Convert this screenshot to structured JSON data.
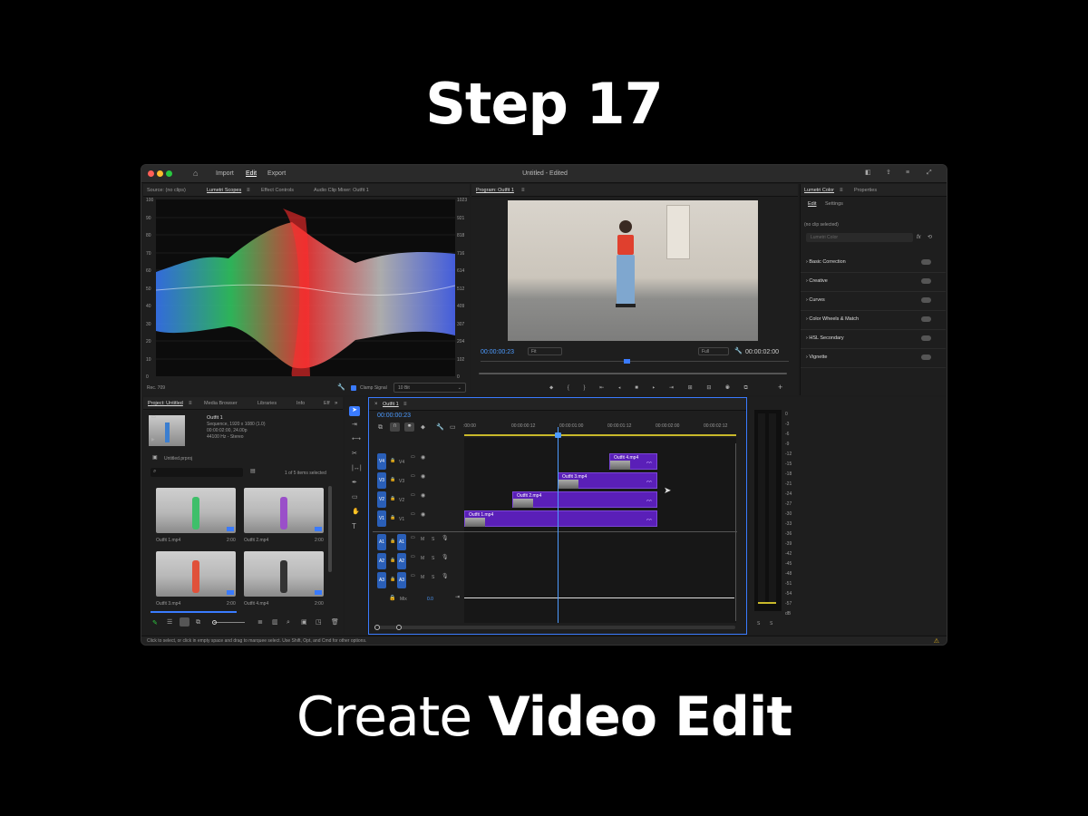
{
  "heading": "Step 17",
  "subheading": {
    "regular": "Create",
    "bold": "Video Edit"
  },
  "app": {
    "title": "Untitled - Edited",
    "menus": [
      "Import",
      "Edit",
      "Export"
    ],
    "source_panel": {
      "tabs": [
        "Source: (no clips)",
        "Lumetri Scopes",
        "Effect Controls",
        "Audio Clip Mixer: Outfit 1"
      ],
      "left_ticks": [
        "100",
        "90",
        "80",
        "70",
        "60",
        "50",
        "40",
        "30",
        "20",
        "10",
        "0"
      ],
      "right_ticks": [
        "1023",
        "921",
        "818",
        "716",
        "614",
        "512",
        "409",
        "307",
        "204",
        "102",
        "0"
      ],
      "footer_left": "Rec. 709",
      "clamp_label": "Clamp Signal",
      "bit_select": "10 Bit"
    },
    "program_panel": {
      "tab": "Program: Outfit 1",
      "timecode": "00:00:00:23",
      "fit": "Fit",
      "quality": "Full",
      "duration": "00:00:02:00"
    },
    "lumetri_panel": {
      "tabs": [
        "Lumetri Color",
        "Properties"
      ],
      "subtabs": [
        "Edit",
        "Settings"
      ],
      "status": "(no clip selected)",
      "dropdown": "Lumetri Color",
      "sections": [
        "Basic Correction",
        "Creative",
        "Curves",
        "Color Wheels & Match",
        "HSL Secondary",
        "Vignette"
      ]
    },
    "project_panel": {
      "tabs": [
        "Project: Untitled",
        "Media Browser",
        "Libraries",
        "Info",
        "Eff"
      ],
      "sequence_name": "Outfit 1",
      "sequence_info": [
        "Sequence, 1920 x 1080 (1.0)",
        "00:00:02:00, 24.00p",
        "44100 Hz - Stereo"
      ],
      "project_file": "Untitled.prproj",
      "selection": "1 of 5 items selected",
      "items": [
        {
          "name": "Outfit 1.mp4",
          "duration": "2:00",
          "color": "#3fbf6a"
        },
        {
          "name": "Outfit 2.mp4",
          "duration": "2:00",
          "color": "#9a4fc9"
        },
        {
          "name": "Outfit 3.mp4",
          "duration": "2:00",
          "color": "#e0513a"
        },
        {
          "name": "Outfit 4.mp4",
          "duration": "2:00",
          "color": "#333333"
        }
      ]
    },
    "timeline": {
      "tab": "Outfit 1",
      "timecode": "00:00:00:23",
      "ruler": [
        ":00:00",
        "00:00:00:12",
        "00:00:01:00",
        "00:00:01:12",
        "00:00:02:00",
        "00:00:02:12"
      ],
      "video_tracks": [
        "V4",
        "V3",
        "V2",
        "V1"
      ],
      "audio_tracks": [
        "A1",
        "A2",
        "A3"
      ],
      "mix_label": "Mix",
      "mix_value": "0.0",
      "clips": [
        "Outfit 4.mp4",
        "Outfit 3.mp4",
        "Outfit 2.mp4",
        "Outfit 1.mp4"
      ]
    },
    "meter": {
      "ticks": [
        "0",
        "-3",
        "-6",
        "-9",
        "-12",
        "-15",
        "-18",
        "-21",
        "-24",
        "-27",
        "-30",
        "-33",
        "-36",
        "-39",
        "-42",
        "-45",
        "-48",
        "-51",
        "-54",
        "-57",
        "dB"
      ],
      "labels": [
        "S",
        "S"
      ]
    },
    "statusbar": "Click to select, or click in empty space and drag to marquee select. Use Shift, Opt, and Cmd for other options."
  }
}
